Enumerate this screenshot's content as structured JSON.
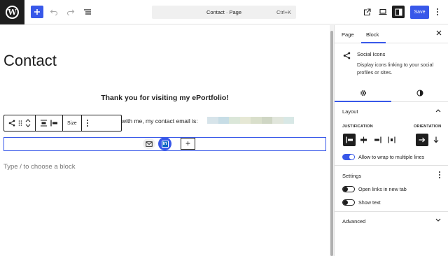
{
  "topbar": {
    "doc_title": "Contact · Page",
    "shortcut": "Ctrl+K",
    "save_label": "Save"
  },
  "canvas": {
    "page_title": "Contact",
    "thanks_text": "Thank you for visiting my ePortfolio!",
    "email_text": "with me, my contact email is:",
    "size_label": "Size",
    "placeholder": "Type / to choose a block"
  },
  "sidebar": {
    "tabs": {
      "page": "Page",
      "block": "Block"
    },
    "block_name": "Social Icons",
    "block_description": "Display icons linking to your social profiles or sites.",
    "layout": {
      "title": "Layout",
      "justification_label": "JUSTIFICATION",
      "orientation_label": "ORIENTATION",
      "wrap_label": "Allow to wrap to multiple lines",
      "wrap_enabled": true
    },
    "settings": {
      "title": "Settings",
      "open_new_tab_label": "Open links in new tab",
      "open_new_tab_enabled": false,
      "show_text_label": "Show text",
      "show_text_enabled": false
    },
    "advanced_title": "Advanced"
  },
  "colors": {
    "accent": "#3858e9",
    "dark": "#1e1e1e",
    "linkedin": "#0a66c2"
  },
  "icons": [
    "wordpress-logo",
    "plus-icon",
    "undo-icon",
    "redo-icon",
    "list-view-icon",
    "external-view-icon",
    "desktop-icon",
    "sidebar-icon",
    "more-vertical-icon",
    "share-icon",
    "drag-icon",
    "move-up-down-icon",
    "justify-center-icon",
    "justify-left-icon",
    "mail-icon",
    "linkedin-icon",
    "close-icon",
    "gear-icon",
    "styles-icon",
    "chevron-up-icon",
    "chevron-down-icon",
    "arrow-right-icon",
    "arrow-down-icon"
  ]
}
